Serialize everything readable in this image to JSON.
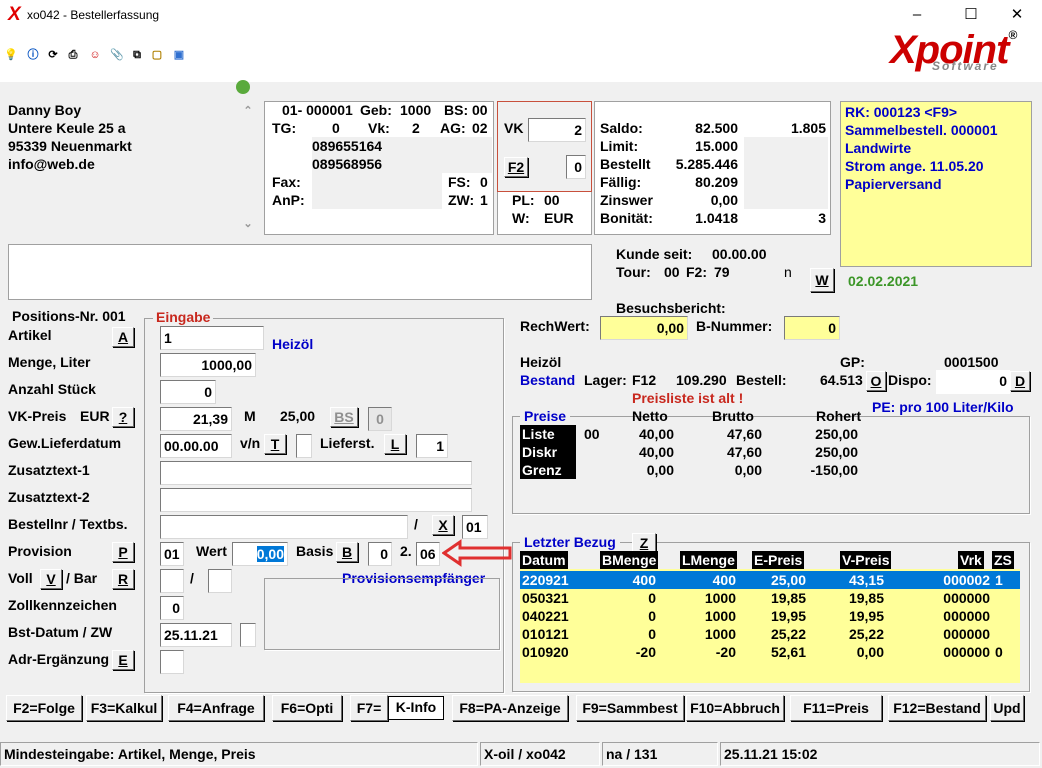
{
  "window": {
    "title": "xo042 - Bestellerfassung",
    "logo_main": "Xpoint",
    "logo_sub": "Software",
    "reg": "®"
  },
  "toolbar": {
    "icons": [
      "bulb-icon",
      "info-icon",
      "refresh-icon",
      "print-icon",
      "people-icon",
      "attach-icon",
      "copy-icon",
      "folder-icon",
      "chat-icon",
      "status-green-icon"
    ]
  },
  "customer": {
    "line1": "Danny Boy",
    "line2": "Untere Keule 25 a",
    "line3": "95339 Neuenmarkt",
    "line4": "info@web.de"
  },
  "custinfo": {
    "num": "01- 000001",
    "geb_l": "Geb:",
    "geb_v": "1000",
    "bs_l": "BS:",
    "bs_v": "00",
    "tg_l": "TG:",
    "tg_v": "0",
    "vk_l": "Vk:",
    "vk_v": "2",
    "ag_l": "AG:",
    "ag_v": "02",
    "tel1": "089655164",
    "tel2": "089568956",
    "fax_l": "Fax:",
    "fs_l": "FS:",
    "fs_v": "0",
    "anp_l": "AnP:",
    "zw_l": "ZW:",
    "zw_v": "1"
  },
  "vk": {
    "label": "VK",
    "value": "2",
    "f2": "F2",
    "f2_val": "0",
    "pl_l": "PL:",
    "pl_v": "00",
    "w_l": "W:",
    "w_v": "EUR"
  },
  "account": {
    "rows": [
      {
        "label": "Saldo:",
        "v1": "82.500",
        "v2": "1.805"
      },
      {
        "label": "Limit:",
        "v1": "15.000",
        "v2": ""
      },
      {
        "label": "Bestellt",
        "v1": "5.285.446",
        "v2": ""
      },
      {
        "label": "Fällig:",
        "v1": "80.209",
        "v2": ""
      },
      {
        "label": "Zinswer",
        "v1": "0,00",
        "v2": ""
      },
      {
        "label": "Bonität:",
        "v1": "1.0418",
        "v2": "3"
      }
    ]
  },
  "rk": {
    "l1": "RK: 000123 <F9>",
    "l2": "Sammelbestell. 000001",
    "l3": "Landwirte",
    "l4": "Strom ange. 11.05.20",
    "l5": "Papierversand"
  },
  "kunde": {
    "seit_l": "Kunde seit:",
    "seit_v": "00.00.00",
    "tour_l": "Tour:",
    "tour_v": "00",
    "f2_l": "F2:",
    "f2_v": "79",
    "n": "n",
    "w_btn": "W",
    "date": "02.02.2021",
    "besuch": "Besuchsbericht:"
  },
  "form": {
    "posnr": "Positions-Nr. 001",
    "eingabe": "Eingabe",
    "artikel_l": "Artikel",
    "artikel_btn": "A",
    "artikel_v": "1",
    "artikel_name": "Heizöl",
    "menge_l": "Menge, Liter",
    "menge_v": "1000,00",
    "stueck_l": "Anzahl Stück",
    "stueck_v": "0",
    "vkpreis_l": "VK-Preis",
    "vkpreis_cur": "EUR",
    "vkpreis_btn": "?",
    "vkpreis_v": "21,39",
    "m_l": "M",
    "m_v": "25,00",
    "bs_btn": "BS",
    "bs_v": "0",
    "gew_l": "Gew.Lieferdatum",
    "gew_v": "00.00.00",
    "vn_l": "v/n",
    "t_btn": "T",
    "lieferst_l": "Lieferst.",
    "l_btn": "L",
    "lieferst_v": "1",
    "zus1_l": "Zusatztext-1",
    "zus2_l": "Zusatztext-2",
    "bestnr_l": "Bestellnr / Textbs.",
    "slash": "/",
    "x_btn": "X",
    "bestnr_v": "01",
    "prov_l": "Provision",
    "p_btn": "P",
    "prov_v": "01",
    "wert_l": "Wert",
    "wert_v": "0,00",
    "basis_l": "Basis",
    "b_btn": "B",
    "basis_v": "0",
    "two": "2.",
    "basis2_v": "06",
    "voll_l": "Voll",
    "v_btn": "V",
    "bar_l": "/ Bar",
    "r_btn": "R",
    "slash2": "/",
    "provempf": "Provisionsempfänger",
    "zoll_l": "Zollkennzeichen",
    "zoll_v": "0",
    "bstdat_l": "Bst-Datum / ZW",
    "bstdat_v": "25.11.21",
    "adr_l": "Adr-Ergänzung",
    "e_btn": "E"
  },
  "right": {
    "rechwert_l": "RechWert:",
    "rechwert_v": "0,00",
    "bnr_l": "B-Nummer:",
    "bnr_v": "0",
    "prod": "Heizöl",
    "gp_l": "GP:",
    "gp_v": "0001500",
    "bestand": "Bestand",
    "lager_l": "Lager:",
    "lager_v": "F12",
    "lager_q": "109.290",
    "bestell_l": "Bestell:",
    "bestell_v": "64.513",
    "o_btn": "O",
    "dispo_l": "Dispo:",
    "dispo_v": "0",
    "d_btn": "D",
    "warn": "Preisliste ist alt !",
    "preise": "Preise",
    "netto": "Netto",
    "brutto": "Brutto",
    "rohert": "Rohert",
    "pe": "PE:  pro 100 Liter/Kilo",
    "prices": [
      {
        "label": "Liste",
        "code": "00",
        "netto": "40,00",
        "brutto": "47,60",
        "rohert": "250,00"
      },
      {
        "label": "Diskr",
        "code": "",
        "netto": "40,00",
        "brutto": "47,60",
        "rohert": "250,00"
      },
      {
        "label": "Grenz",
        "code": "",
        "netto": "0,00",
        "brutto": "0,00",
        "rohert": "-150,00"
      }
    ],
    "letzter": "Letzter Bezug",
    "z_btn": "Z",
    "hist_cols": [
      "Datum",
      "BMenge",
      "LMenge",
      "E-Preis",
      "V-Preis",
      "Vrk",
      "ZS"
    ],
    "hist": [
      {
        "d": "220921",
        "b": "400",
        "l": "400",
        "e": "25,00",
        "v": "43,15",
        "vrk": "000002",
        "zs": "1"
      },
      {
        "d": "050321",
        "b": "0",
        "l": "1000",
        "e": "19,85",
        "v": "19,85",
        "vrk": "000000",
        "zs": ""
      },
      {
        "d": "040221",
        "b": "0",
        "l": "1000",
        "e": "19,95",
        "v": "19,95",
        "vrk": "000000",
        "zs": ""
      },
      {
        "d": "010121",
        "b": "0",
        "l": "1000",
        "e": "25,22",
        "v": "25,22",
        "vrk": "000000",
        "zs": ""
      },
      {
        "d": "010920",
        "b": "-20",
        "l": "-20",
        "e": "52,61",
        "v": "0,00",
        "vrk": "000000",
        "zs": "0"
      }
    ]
  },
  "fkeys": [
    "F2=Folge",
    "F3=Kalkul",
    "F4=Anfrage",
    "F6=Opti",
    "F7=",
    "K-Info",
    "F8=PA-Anzeige",
    "F9=Sammbest",
    "F10=Abbruch",
    "F11=Preis",
    "F12=Bestand",
    "Upd"
  ],
  "status": {
    "hint": "Mindesteingabe: Artikel, Menge, Preis",
    "prog": "X-oil / xo042",
    "na": "na / 131",
    "dt": "25.11.21 15:02"
  },
  "colors": {
    "blue": "#0000c8",
    "red": "#c8281e",
    "yellow": "#ffff99",
    "select": "#0078d7"
  }
}
